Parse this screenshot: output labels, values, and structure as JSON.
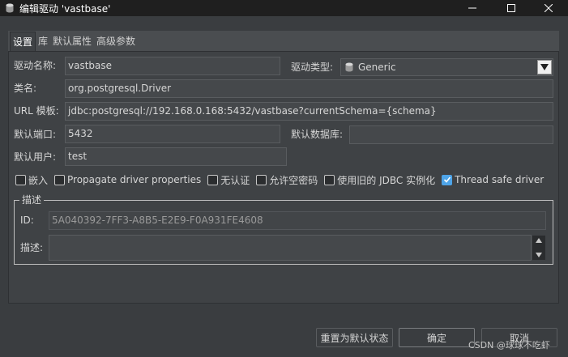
{
  "window": {
    "title": "编辑驱动 'vastbase'",
    "minimize_icon": "minimize-icon",
    "maximize_icon": "maximize-icon",
    "close_icon": "close-icon"
  },
  "tabs": [
    {
      "label": "设置",
      "active": true
    },
    {
      "label": "库",
      "active": false
    },
    {
      "label": "默认属性",
      "active": false
    },
    {
      "label": "高级参数",
      "active": false
    }
  ],
  "form": {
    "driver_name_label": "驱动名称:",
    "driver_name_value": "vastbase",
    "driver_type_label": "驱动类型:",
    "driver_type_value": "Generic",
    "class_label": "类名:",
    "class_value": "org.postgresql.Driver",
    "url_label": "URL 模板:",
    "url_value": "jdbc:postgresql://192.168.0.168:5432/vastbase?currentSchema={schema}",
    "port_label": "默认端口:",
    "port_value": "5432",
    "database_label": "默认数据库:",
    "database_value": "",
    "user_label": "默认用户:",
    "user_value": "test"
  },
  "options": [
    {
      "label": "嵌入",
      "checked": false
    },
    {
      "label": "Propagate driver properties",
      "checked": false
    },
    {
      "label": "无认证",
      "checked": false
    },
    {
      "label": "允许空密码",
      "checked": false
    },
    {
      "label": "使用旧的 JDBC 实例化",
      "checked": false
    },
    {
      "label": "Thread safe driver",
      "checked": true
    }
  ],
  "description_group": {
    "title": "描述",
    "id_label": "ID:",
    "id_value": "5A040392-7FF3-A8B5-E2E9-F0A931FE4608",
    "desc_label": "描述:",
    "desc_value": ""
  },
  "buttons": {
    "reset": "重置为默认状态",
    "ok": "确定",
    "cancel": "取消"
  },
  "watermark": "CSDN @球球不吃虾",
  "colors": {
    "check_on": "#4ea4e8",
    "background": "#3a3d40",
    "titlebar": "#1f1f1f"
  }
}
